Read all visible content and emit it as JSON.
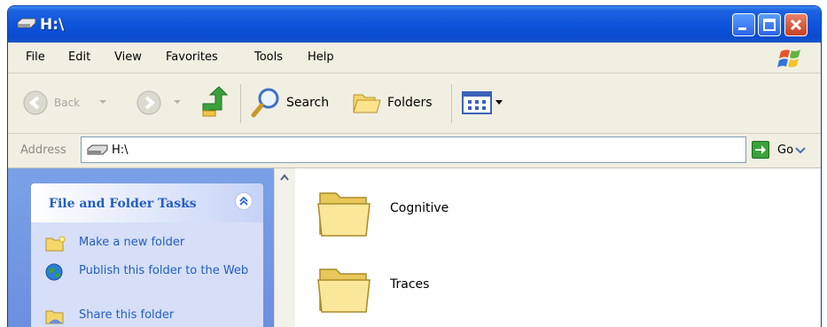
{
  "window": {
    "title": "H:\\"
  },
  "menu": [
    "File",
    "Edit",
    "View",
    "Favorites",
    "Tools",
    "Help"
  ],
  "toolbar": {
    "back_label": "Back",
    "search_label": "Search",
    "folders_label": "Folders"
  },
  "address": {
    "label": "Address",
    "value": "H:\\",
    "go_label": "Go"
  },
  "tasks_panel": {
    "title": "File and Folder Tasks",
    "items": [
      {
        "label": "Make a new folder",
        "icon": "new-folder-icon"
      },
      {
        "label": "Publish this folder to the Web",
        "icon": "globe-icon"
      },
      {
        "label": "Share this folder",
        "icon": "share-folder-icon"
      }
    ]
  },
  "folders": [
    {
      "name": "Cognitive",
      "icon": "folder-icon"
    },
    {
      "name": "Traces",
      "icon": "folder-icon"
    }
  ],
  "colors": {
    "titlebar": "#0d54dc",
    "task_link": "#215dc6",
    "left_pane": "#7aa1e6"
  }
}
